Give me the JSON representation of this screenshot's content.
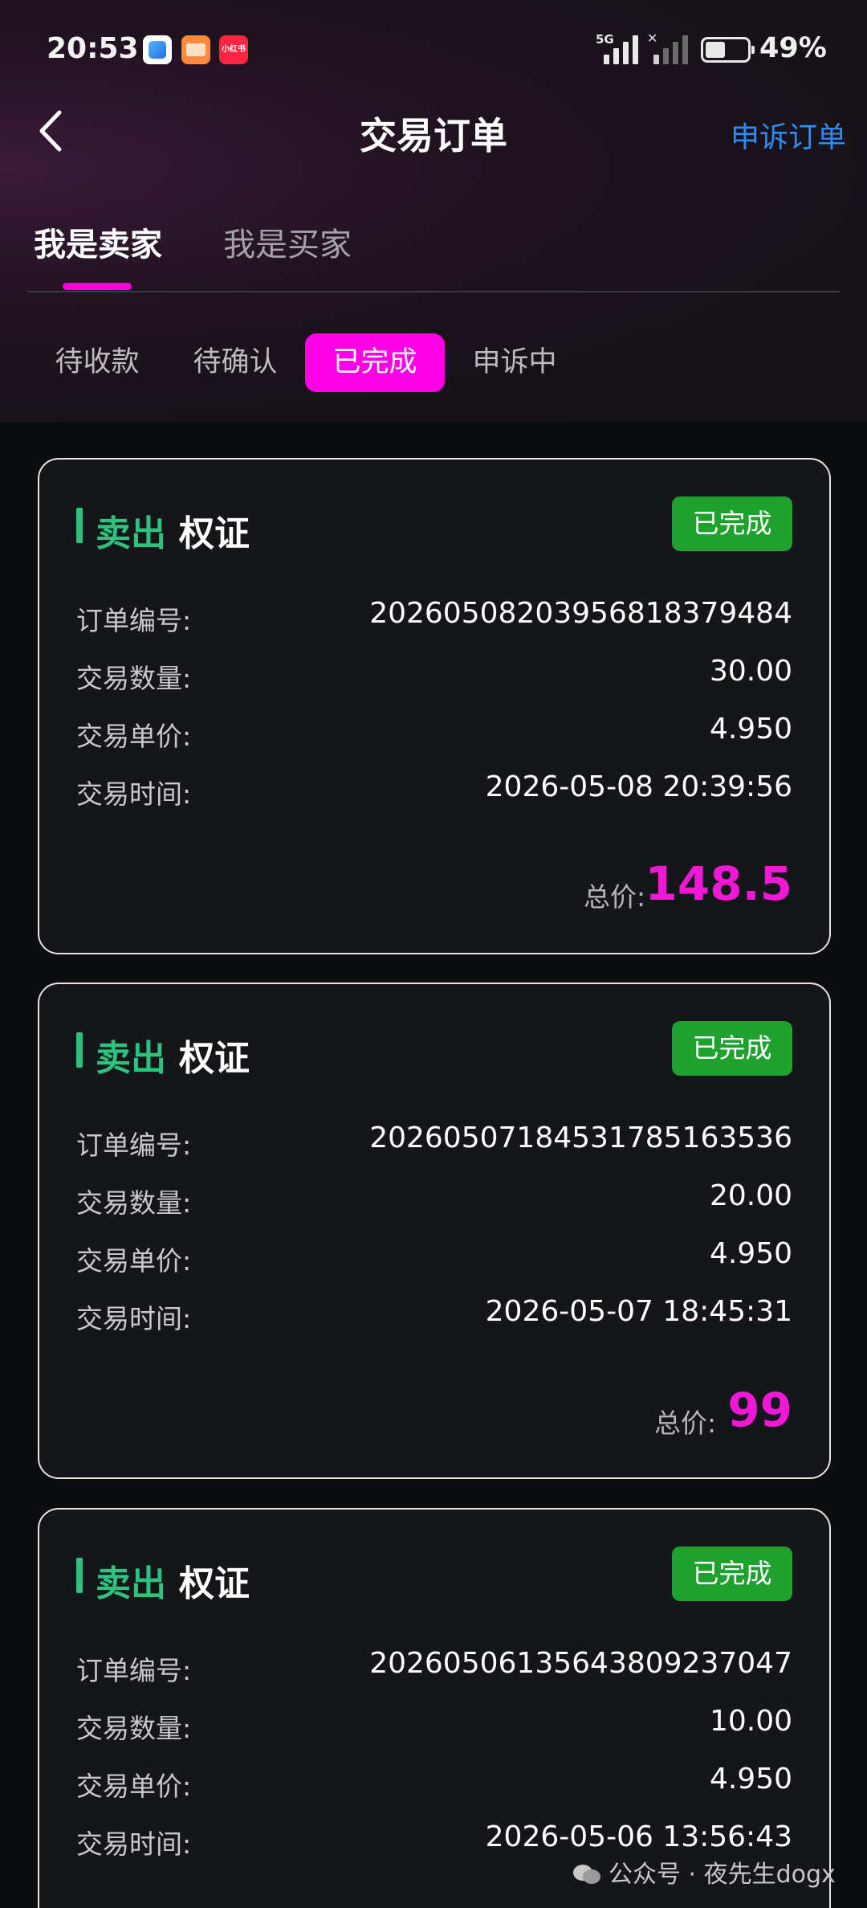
{
  "status_bar": {
    "time": "20:53",
    "network": "5G",
    "battery": "49%",
    "app_icons": [
      "blue-app-icon",
      "orange-app-icon",
      "xiaohongshu-app-icon"
    ],
    "xhs_label": "小红书"
  },
  "header": {
    "title": "交易订单",
    "appeal_link": "申诉订单"
  },
  "role_tabs": [
    {
      "label": "我是卖家",
      "active": true
    },
    {
      "label": "我是买家",
      "active": false
    }
  ],
  "status_tabs": [
    {
      "label": "待收款",
      "active": false
    },
    {
      "label": "待确认",
      "active": false
    },
    {
      "label": "已完成",
      "active": true
    },
    {
      "label": "申诉中",
      "active": false
    }
  ],
  "field_labels": {
    "order_no": "订单编号:",
    "quantity": "交易数量:",
    "unit_price": "交易单价:",
    "time": "交易时间:",
    "total": "总价:"
  },
  "orders": [
    {
      "side": "卖出",
      "asset": "权证",
      "status": "已完成",
      "order_no": "20260508203956818379484",
      "quantity": "30.00",
      "unit_price": "4.950",
      "time": "2026-05-08 20:39:56",
      "total": "148.5"
    },
    {
      "side": "卖出",
      "asset": "权证",
      "status": "已完成",
      "order_no": "20260507184531785163536",
      "quantity": "20.00",
      "unit_price": "4.950",
      "time": "2026-05-07 18:45:31",
      "total": "99"
    },
    {
      "side": "卖出",
      "asset": "权证",
      "status": "已完成",
      "order_no": "20260506135643809237047",
      "quantity": "10.00",
      "unit_price": "4.950",
      "time": "2026-05-06 13:56:43"
    }
  ],
  "watermark": "公众号 · 夜先生dogx",
  "colors": {
    "accent_pink": "#ff00e6",
    "sell_green": "#2ec27e",
    "badge_green": "#1fa22d",
    "total_pink": "#f017d6",
    "link_blue": "#2f8cf5"
  }
}
